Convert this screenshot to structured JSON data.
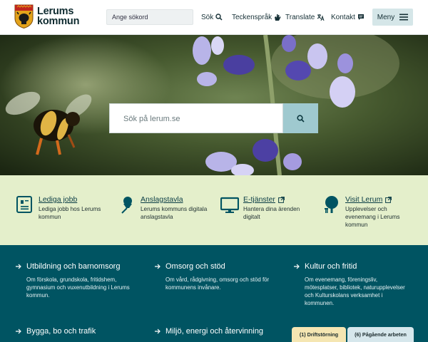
{
  "header": {
    "logo_line1": "Lerums",
    "logo_line2": "kommun",
    "search_placeholder": "Ange sökord",
    "nav": [
      {
        "label": "Sök",
        "icon": "search-icon"
      },
      {
        "label": "Teckenspråk",
        "icon": "sign-language-icon"
      },
      {
        "label": "Translate",
        "icon": "translate-icon"
      },
      {
        "label": "Kontakt",
        "icon": "chat-icon"
      }
    ],
    "menu_label": "Meny"
  },
  "hero": {
    "search_placeholder": "Sök på lerum.se"
  },
  "quick_links": [
    {
      "title": "Lediga jobb",
      "desc": [
        "Lediga jobb hos Lerums",
        "kommun"
      ],
      "icon": "badge-icon",
      "external": false
    },
    {
      "title": "Anslagstavla",
      "desc": [
        "Lerums kommuns digitala",
        "anslagstavla"
      ],
      "icon": "pushpin-icon",
      "external": false
    },
    {
      "title": "E-tjänster",
      "desc": [
        "Hantera dina ärenden",
        "digitalt"
      ],
      "icon": "monitor-icon",
      "external": true
    },
    {
      "title": "Visit Lerum",
      "desc": [
        "Upplevelser och",
        "evenemang i Lerums",
        "kommun"
      ],
      "icon": "tree-icon",
      "external": true
    }
  ],
  "categories": [
    {
      "title": "Utbildning och barnomsorg",
      "desc": [
        "Om förskola, grundskola, fritidshem,",
        "gymnasium och vuxenutbildning i Lerums",
        "kommun."
      ]
    },
    {
      "title": "Omsorg och stöd",
      "desc": [
        "Om vård, rådgivning, omsorg och stöd för",
        "kommunens invånare."
      ]
    },
    {
      "title": "Kultur och fritid",
      "desc": [
        "Om evenemang, föreningsliv,",
        "mötesplatser, bibliotek, naturupplevelser",
        "och Kulturskolans verksamhet i",
        "kommunen."
      ]
    },
    {
      "title": "Bygga, bo och trafik",
      "desc": []
    },
    {
      "title": "Miljö, energi och återvinning",
      "desc": []
    }
  ],
  "status_tabs": [
    {
      "label": "(1) Driftstörning",
      "color": "#f5e6b2"
    },
    {
      "label": "(6) Pågående arbeten",
      "color": "#d6e7ec"
    }
  ],
  "colors": {
    "teal": "#005462",
    "light_green": "#e4efcb",
    "search_button": "#9fc9cf",
    "menu_button": "#d5e6e8"
  }
}
